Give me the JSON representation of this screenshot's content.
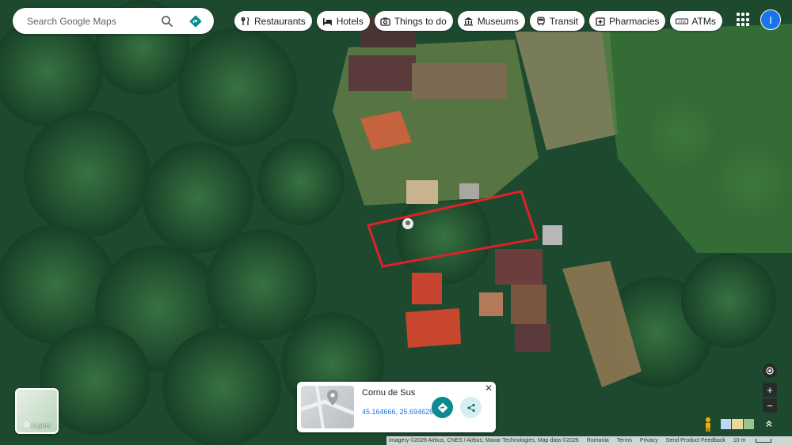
{
  "search": {
    "placeholder": "Search Google Maps"
  },
  "chips": [
    {
      "label": "Restaurants",
      "icon": "fork-knife-icon"
    },
    {
      "label": "Hotels",
      "icon": "bed-icon"
    },
    {
      "label": "Things to do",
      "icon": "camera-icon"
    },
    {
      "label": "Museums",
      "icon": "museum-icon"
    },
    {
      "label": "Transit",
      "icon": "train-icon"
    },
    {
      "label": "Pharmacies",
      "icon": "pharmacy-icon"
    },
    {
      "label": "ATMs",
      "icon": "atm-icon"
    }
  ],
  "account": {
    "initial": "I"
  },
  "layers": {
    "label": "Layers"
  },
  "place_card": {
    "title": "Cornu de Sus",
    "coords": "45.164666, 25.694625"
  },
  "footer": {
    "imagery": "Imagery ©2026 Airbus, CNES / Airbus, Maxar Technologies, Map data ©2026",
    "region": "Romania",
    "terms": "Terms",
    "privacy": "Privacy",
    "feedback": "Send Product Feedback",
    "scale": "10 m"
  },
  "colors": {
    "selection_outline": "#e0202a",
    "accent": "#0b8a8f",
    "link": "#1a73e8"
  }
}
